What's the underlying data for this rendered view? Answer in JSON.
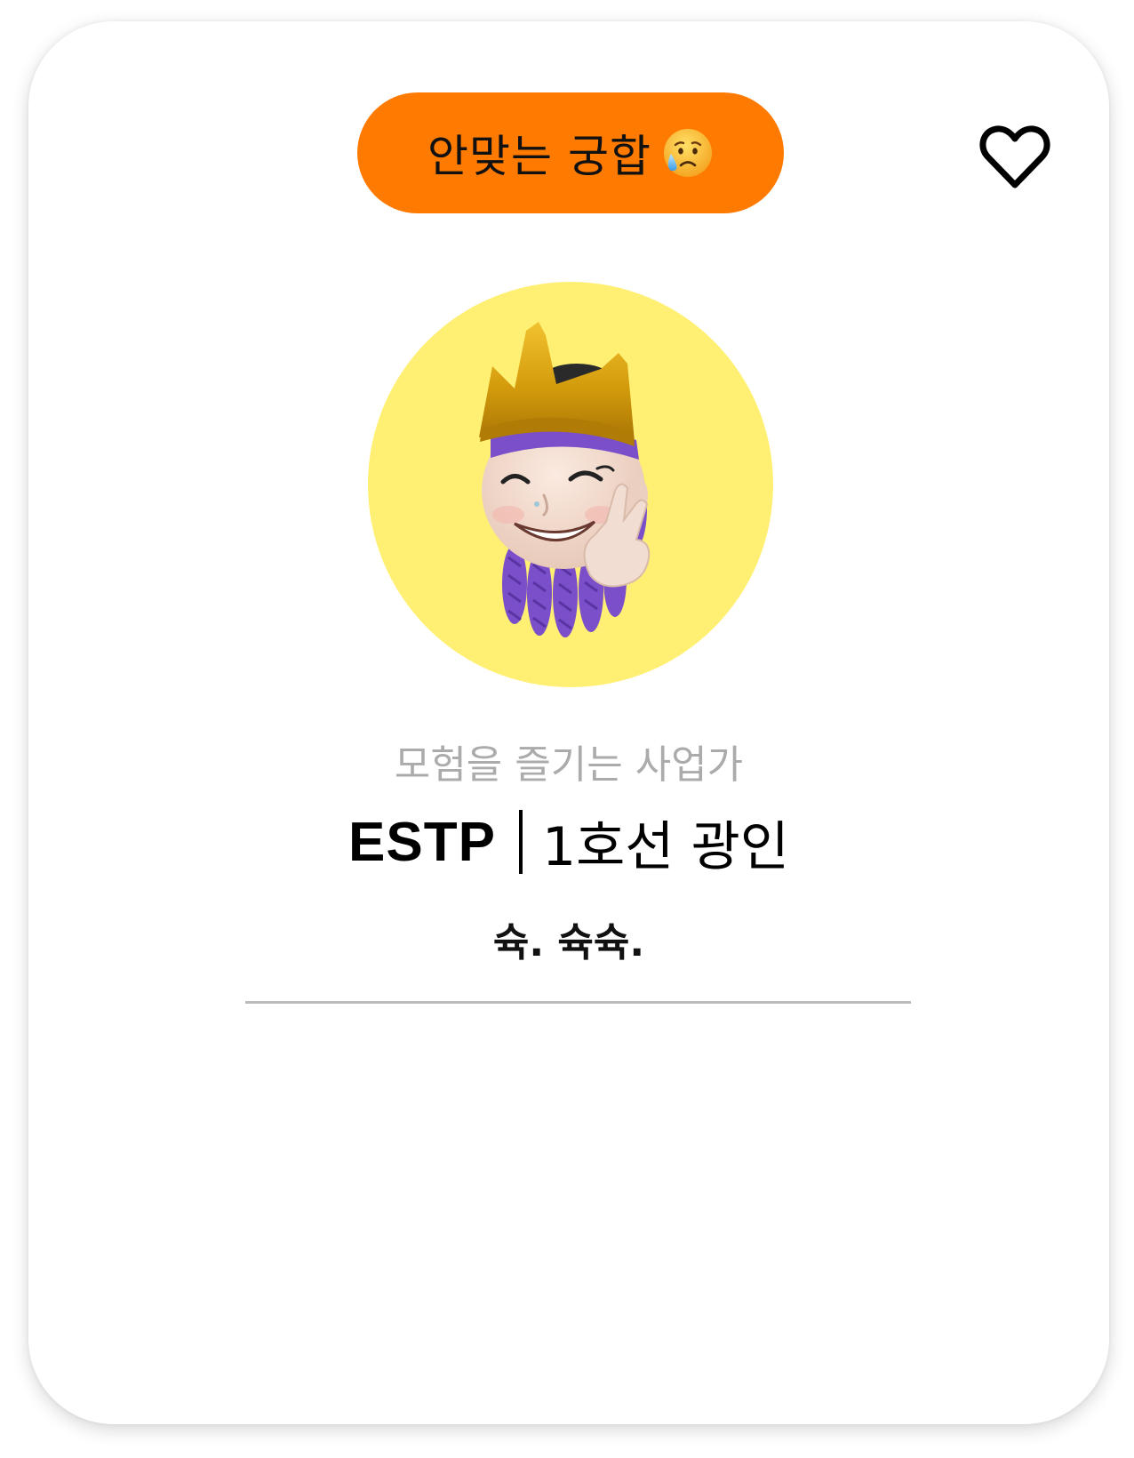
{
  "match_badge": {
    "label": "안맞는 궁합",
    "emoji_icon": "sad-sweat-face-icon",
    "background_color": "#FF7A00"
  },
  "favorite": {
    "icon": "heart-outline-icon",
    "liked": false
  },
  "profile": {
    "avatar_icon": "memoji-crown-avatar",
    "avatar_background": "#FFF073",
    "tagline": "모험을 즐기는 사업가",
    "mbti": "ESTP",
    "nickname": "1호선 광인",
    "status_message": "슉. 슉슉."
  }
}
